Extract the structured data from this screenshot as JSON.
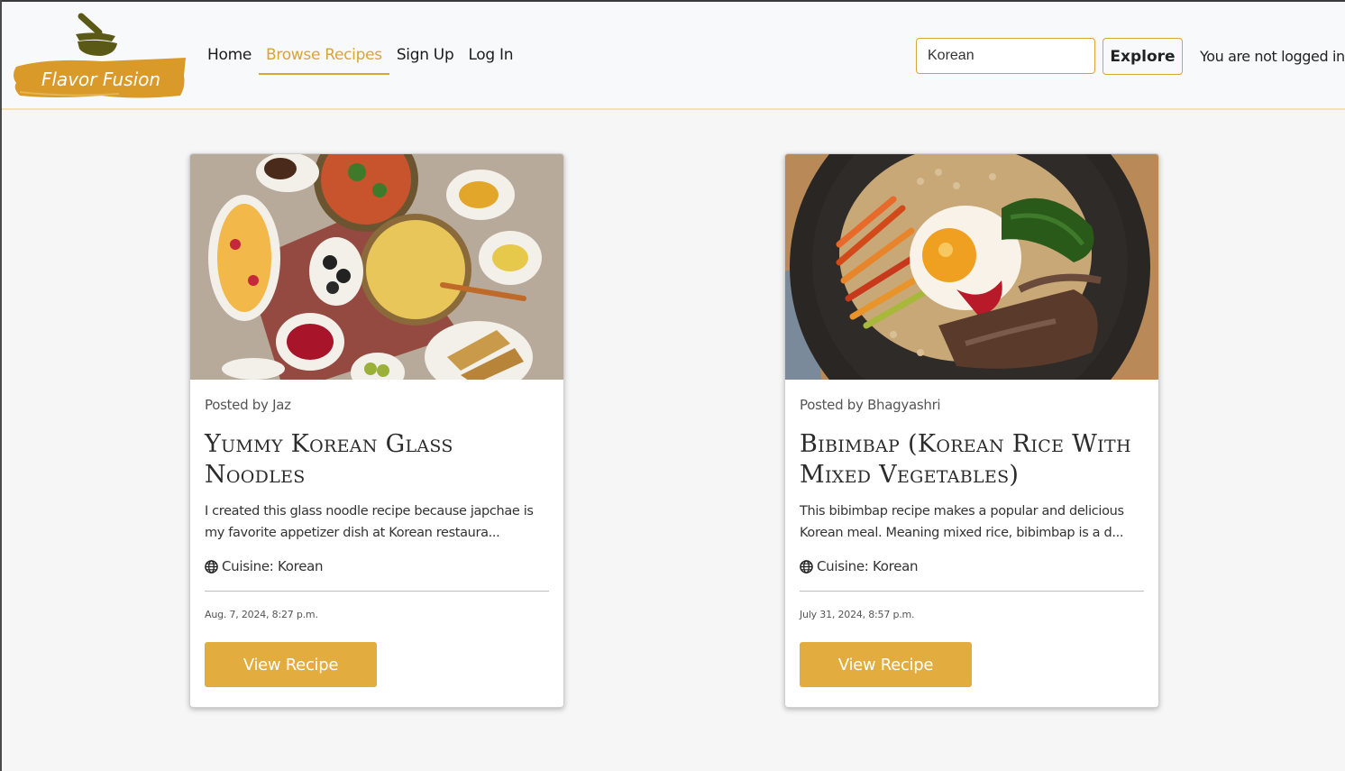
{
  "brand": {
    "name": "Flavor Fusion",
    "logo_icon": "mortar-pestle-icon"
  },
  "nav": {
    "items": [
      {
        "label": "Home",
        "active": false
      },
      {
        "label": "Browse Recipes",
        "active": true
      },
      {
        "label": "Sign Up",
        "active": false
      },
      {
        "label": "Log In",
        "active": false
      }
    ]
  },
  "search": {
    "value": "Korean",
    "button_label": "Explore"
  },
  "auth": {
    "status": "You are not logged in"
  },
  "colors": {
    "accent": "#e2ac3f",
    "logo_dark": "#5a5a16",
    "background": "#f6f6f6"
  },
  "recipes": [
    {
      "posted_by": "Posted by Jaz",
      "title": "Yummy Korean Glass Noodles",
      "excerpt": "I created this glass noodle recipe because japchae is my favorite appetizer dish at Korean restaura...",
      "cuisine": "Cuisine: Korean",
      "cuisine_icon": "globe-icon",
      "date": "Aug. 7, 2024, 8:27 p.m.",
      "button_label": "View Recipe"
    },
    {
      "posted_by": "Posted by Bhagyashri",
      "title": "Bibimbap (Korean Rice With Mixed Vegetables)",
      "excerpt": "This bibimbap recipe makes a popular and delicious Korean meal. Meaning mixed rice, bibimbap is a d...",
      "cuisine": "Cuisine: Korean",
      "cuisine_icon": "globe-icon",
      "date": "July 31, 2024, 8:57 p.m.",
      "button_label": "View Recipe"
    }
  ]
}
